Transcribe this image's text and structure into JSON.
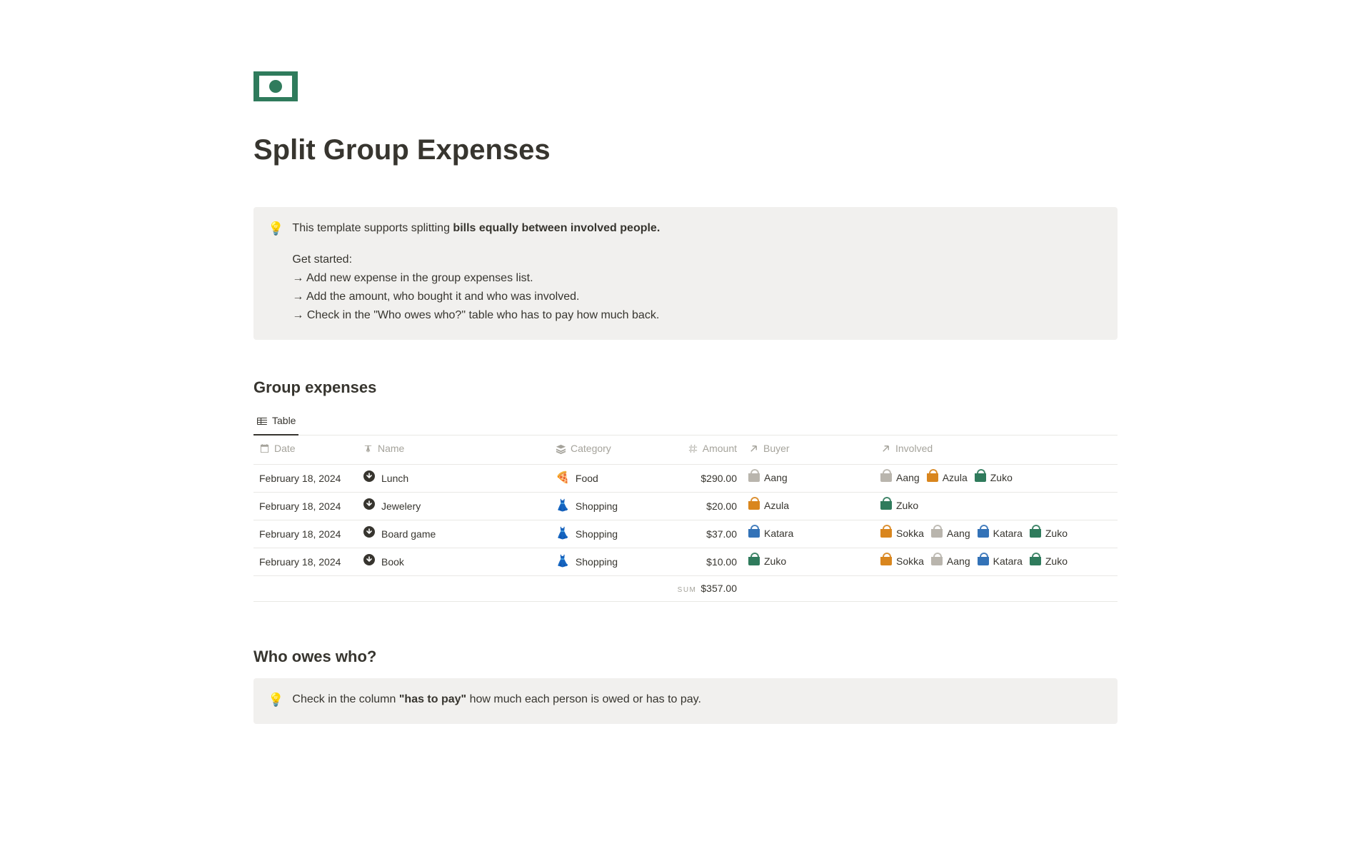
{
  "page_title": "Split Group Expenses",
  "callout1": {
    "intro_prefix": "This template supports splitting ",
    "intro_bold": "bills equally between involved people.",
    "get_started_label": "Get started:",
    "steps": [
      "→ Add new expense in the group expenses list.",
      "→ Add the amount, who bought it and who was involved.",
      "→ Check in the \"Who owes who?\" table who has to pay how much back."
    ]
  },
  "group_expenses": {
    "heading": "Group expenses",
    "tab_label": "Table",
    "columns": {
      "date": "Date",
      "name": "Name",
      "category": "Category",
      "amount": "Amount",
      "buyer": "Buyer",
      "involved": "Involved"
    },
    "rows": [
      {
        "date": "February 18, 2024",
        "name": "Lunch",
        "category": {
          "emoji": "🍕",
          "label": "Food"
        },
        "amount": "$290.00",
        "buyer": {
          "name": "Aang",
          "color": "grey"
        },
        "involved": [
          {
            "name": "Aang",
            "color": "grey"
          },
          {
            "name": "Azula",
            "color": "orange"
          },
          {
            "name": "Zuko",
            "color": "green"
          }
        ]
      },
      {
        "date": "February 18, 2024",
        "name": "Jewelery",
        "category": {
          "emoji": "👗",
          "label": "Shopping"
        },
        "amount": "$20.00",
        "buyer": {
          "name": "Azula",
          "color": "orange"
        },
        "involved": [
          {
            "name": "Zuko",
            "color": "green"
          }
        ]
      },
      {
        "date": "February 18, 2024",
        "name": "Board game",
        "category": {
          "emoji": "👗",
          "label": "Shopping"
        },
        "amount": "$37.00",
        "buyer": {
          "name": "Katara",
          "color": "blue"
        },
        "involved": [
          {
            "name": "Sokka",
            "color": "orange"
          },
          {
            "name": "Aang",
            "color": "grey"
          },
          {
            "name": "Katara",
            "color": "blue"
          },
          {
            "name": "Zuko",
            "color": "green"
          }
        ]
      },
      {
        "date": "February 18, 2024",
        "name": "Book",
        "category": {
          "emoji": "👗",
          "label": "Shopping"
        },
        "amount": "$10.00",
        "buyer": {
          "name": "Zuko",
          "color": "green"
        },
        "involved": [
          {
            "name": "Sokka",
            "color": "orange"
          },
          {
            "name": "Aang",
            "color": "grey"
          },
          {
            "name": "Katara",
            "color": "blue"
          },
          {
            "name": "Zuko",
            "color": "green"
          }
        ]
      }
    ],
    "sum_label": "SUM",
    "sum_value": "$357.00"
  },
  "owes": {
    "heading": "Who owes who?",
    "callout_prefix": "Check in the column ",
    "callout_bold": "\"has to pay\"",
    "callout_suffix": " how much each person is owed or has to pay."
  }
}
